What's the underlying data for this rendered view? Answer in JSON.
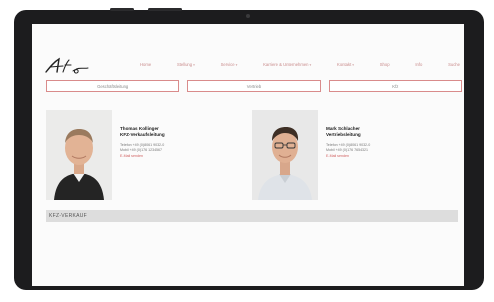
{
  "nav": {
    "items": [
      {
        "label": "Home",
        "has_dropdown": false
      },
      {
        "label": "Stellung",
        "has_dropdown": true
      },
      {
        "label": "Service",
        "has_dropdown": true
      },
      {
        "label": "Karriere & Unternehmen",
        "has_dropdown": true
      },
      {
        "label": "Kontakt",
        "has_dropdown": true
      },
      {
        "label": "Shop",
        "has_dropdown": false
      },
      {
        "label": "Info",
        "has_dropdown": false
      },
      {
        "label": "Suche",
        "has_dropdown": false
      }
    ]
  },
  "categories": [
    {
      "label": "Geschäftsleitung"
    },
    {
      "label": "Vertrieb"
    },
    {
      "label": "Kfz"
    }
  ],
  "contacts": [
    {
      "name": "Thomas Kollinger",
      "role": "KFZ-Verkaufsleitung",
      "phone": "Telefon +49 (0)8061 9032-0",
      "mobile": "Mobil +49 (0)176 1234567",
      "email_link": "E-Mail senden"
    },
    {
      "name": "Mark Schlacher",
      "role": "Vertriebsleitung",
      "phone": "Telefon +49 (0)8061 9032-0",
      "mobile": "Mobil +49 (0)176 7654321",
      "email_link": "E-Mail senden"
    }
  ],
  "section": {
    "title": "KFZ-VERKAUF"
  },
  "colors": {
    "accent": "#d98b8b",
    "link": "#d06060",
    "bezel": "#1c1c1e",
    "section_bar": "#dddddd"
  }
}
